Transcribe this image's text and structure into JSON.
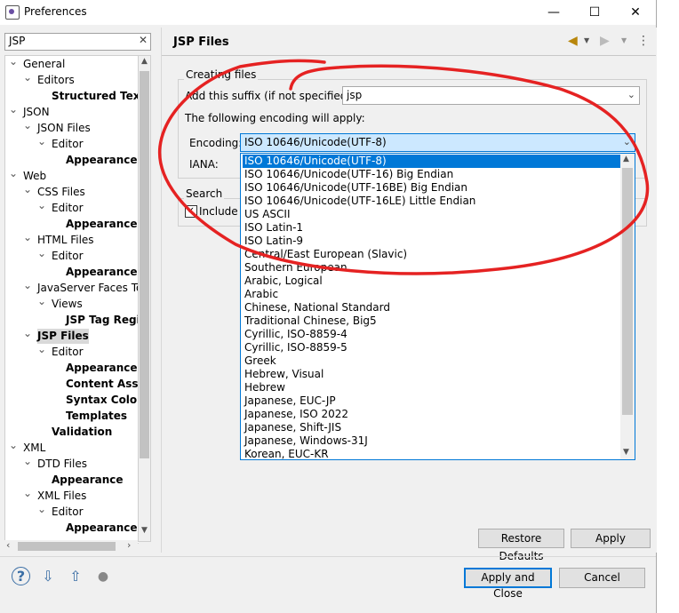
{
  "window": {
    "title": "Preferences",
    "minimize": "—",
    "maximize": "☐",
    "close": "✕"
  },
  "filter": {
    "value": "JSP",
    "clear": "✕"
  },
  "tree": [
    {
      "label": "General",
      "bold": false,
      "indent": 0,
      "twisty": "v"
    },
    {
      "label": "Editors",
      "bold": false,
      "indent": 1,
      "twisty": "v"
    },
    {
      "label": "Structured Text",
      "bold": true,
      "indent": 2,
      "twisty": ""
    },
    {
      "label": "JSON",
      "bold": false,
      "indent": 0,
      "twisty": "v"
    },
    {
      "label": "JSON Files",
      "bold": false,
      "indent": 1,
      "twisty": "v"
    },
    {
      "label": "Editor",
      "bold": false,
      "indent": 2,
      "twisty": "v"
    },
    {
      "label": "Appearance",
      "bold": true,
      "indent": 3,
      "twisty": ""
    },
    {
      "label": "Web",
      "bold": false,
      "indent": 0,
      "twisty": "v"
    },
    {
      "label": "CSS Files",
      "bold": false,
      "indent": 1,
      "twisty": "v"
    },
    {
      "label": "Editor",
      "bold": false,
      "indent": 2,
      "twisty": "v"
    },
    {
      "label": "Appearance",
      "bold": true,
      "indent": 3,
      "twisty": ""
    },
    {
      "label": "HTML Files",
      "bold": false,
      "indent": 1,
      "twisty": "v"
    },
    {
      "label": "Editor",
      "bold": false,
      "indent": 2,
      "twisty": "v"
    },
    {
      "label": "Appearance",
      "bold": true,
      "indent": 3,
      "twisty": ""
    },
    {
      "label": "JavaServer Faces Too",
      "bold": false,
      "indent": 1,
      "twisty": "v"
    },
    {
      "label": "Views",
      "bold": false,
      "indent": 2,
      "twisty": "v"
    },
    {
      "label": "JSP Tag Regis",
      "bold": true,
      "indent": 3,
      "twisty": ""
    },
    {
      "label": "JSP Files",
      "bold": true,
      "indent": 1,
      "twisty": "v",
      "selected": true
    },
    {
      "label": "Editor",
      "bold": false,
      "indent": 2,
      "twisty": "v"
    },
    {
      "label": "Appearance",
      "bold": true,
      "indent": 3,
      "twisty": ""
    },
    {
      "label": "Content Assis",
      "bold": true,
      "indent": 3,
      "twisty": ""
    },
    {
      "label": "Syntax Colorin",
      "bold": true,
      "indent": 3,
      "twisty": ""
    },
    {
      "label": "Templates",
      "bold": true,
      "indent": 3,
      "twisty": ""
    },
    {
      "label": "Validation",
      "bold": true,
      "indent": 2,
      "twisty": ""
    },
    {
      "label": "XML",
      "bold": false,
      "indent": 0,
      "twisty": "v"
    },
    {
      "label": "DTD Files",
      "bold": false,
      "indent": 1,
      "twisty": "v"
    },
    {
      "label": "Appearance",
      "bold": true,
      "indent": 2,
      "twisty": ""
    },
    {
      "label": "XML Files",
      "bold": false,
      "indent": 1,
      "twisty": "v"
    },
    {
      "label": "Editor",
      "bold": false,
      "indent": 2,
      "twisty": "v"
    },
    {
      "label": "Appearance",
      "bold": true,
      "indent": 3,
      "twisty": ""
    }
  ],
  "page": {
    "title": "JSP Files",
    "creating_group": "Creating files",
    "suffix_label": "Add this suffix (if not specified):",
    "suffix_value": "jsp",
    "encoding_intro": "The following encoding will apply:",
    "encoding_label": "Encoding:",
    "encoding_value": "ISO 10646/Unicode(UTF-8)",
    "iana_label": "IANA:",
    "search_group": "Search",
    "include_label": "Include J"
  },
  "encodings": [
    "ISO 10646/Unicode(UTF-8)",
    "ISO 10646/Unicode(UTF-16) Big Endian",
    "ISO 10646/Unicode(UTF-16BE) Big Endian",
    "ISO 10646/Unicode(UTF-16LE) Little Endian",
    "US ASCII",
    "ISO Latin-1",
    "ISO Latin-9",
    "Central/East European (Slavic)",
    "Southern European",
    "Arabic, Logical",
    "Arabic",
    "Chinese, National Standard",
    "Traditional Chinese, Big5",
    "Cyrillic, ISO-8859-4",
    "Cyrillic, ISO-8859-5",
    "Greek",
    "Hebrew, Visual",
    "Hebrew",
    "Japanese, EUC-JP",
    "Japanese, ISO 2022",
    "Japanese, Shift-JIS",
    "Japanese, Windows-31J",
    "Korean, EUC-KR"
  ],
  "buttons": {
    "restore": "Restore Defaults",
    "apply": "Apply",
    "apply_close": "Apply and Close",
    "cancel": "Cancel"
  },
  "icons": {
    "back": "◀",
    "forward": "▶",
    "menu": "⋮",
    "help": "?",
    "import": "⇩",
    "export": "⇧",
    "record": "●",
    "chevron": "⌄",
    "check": "✓"
  },
  "colors": {
    "selection": "#0078d7",
    "annotation": "#e52222"
  }
}
